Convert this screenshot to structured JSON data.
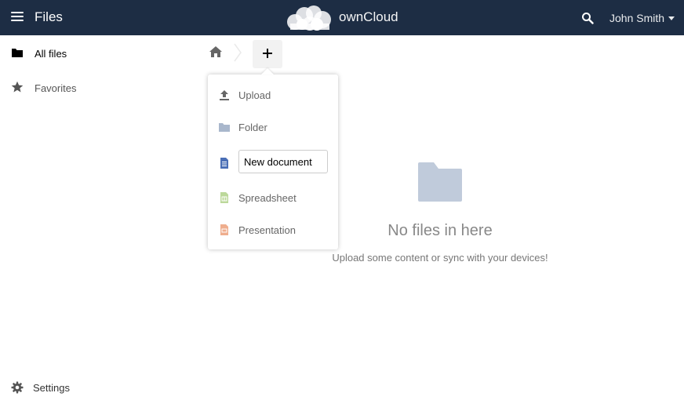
{
  "header": {
    "app_title": "Files",
    "brand": "ownCloud",
    "user": "John Smith",
    "background": "#1d2d44"
  },
  "sidebar": {
    "items": [
      {
        "label": "All files",
        "icon": "folder-icon",
        "active": true
      },
      {
        "label": "Favorites",
        "icon": "star-icon",
        "active": false
      }
    ],
    "settings_label": "Settings"
  },
  "new_menu": {
    "items": [
      {
        "label": "Upload",
        "icon": "upload-icon"
      },
      {
        "label": "Folder",
        "icon": "folder-icon"
      },
      {
        "label": "Spreadsheet",
        "icon": "spreadsheet-icon"
      },
      {
        "label": "Presentation",
        "icon": "presentation-icon"
      }
    ],
    "document_input_value": "New document"
  },
  "empty_state": {
    "title": "No files in here",
    "subtitle": "Upload some content or sync with your devices!",
    "icon": "folder-icon"
  },
  "colors": {
    "folder": "#a9b7cc",
    "document": "#4a6fb6",
    "spreadsheet": "#9fc570",
    "presentation": "#e89067"
  }
}
